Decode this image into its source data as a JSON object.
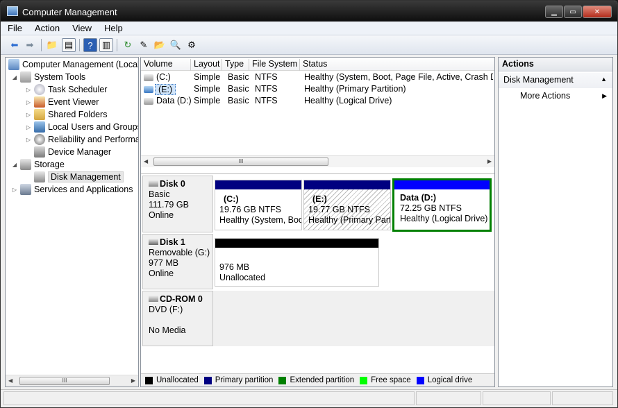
{
  "window": {
    "title": "Computer Management",
    "minimize": "▁",
    "maximize": "▭",
    "close": "✕"
  },
  "menu": [
    "File",
    "Action",
    "View",
    "Help"
  ],
  "tree": {
    "root": "Computer Management (Local",
    "system_tools": "System Tools",
    "task_scheduler": "Task Scheduler",
    "event_viewer": "Event Viewer",
    "shared_folders": "Shared Folders",
    "local_users": "Local Users and Groups",
    "reliability": "Reliability and Performa",
    "device_manager": "Device Manager",
    "storage": "Storage",
    "disk_management": "Disk Management",
    "services": "Services and Applications"
  },
  "volumes": {
    "headers": [
      "Volume",
      "Layout",
      "Type",
      "File System",
      "Status"
    ],
    "rows": [
      {
        "volume": "(C:)",
        "layout": "Simple",
        "type": "Basic",
        "fs": "NTFS",
        "status": "Healthy (System, Boot, Page File, Active, Crash Dum"
      },
      {
        "volume": "(E:)",
        "layout": "Simple",
        "type": "Basic",
        "fs": "NTFS",
        "status": "Healthy (Primary Partition)"
      },
      {
        "volume": "Data (D:)",
        "layout": "Simple",
        "type": "Basic",
        "fs": "NTFS",
        "status": "Healthy (Logical Drive)"
      }
    ]
  },
  "disks": {
    "disk0": {
      "name": "Disk 0",
      "type": "Basic",
      "size": "111.79 GB",
      "state": "Online"
    },
    "disk1": {
      "name": "Disk 1",
      "type": "Removable (G:)",
      "size": "977 MB",
      "state": "Online"
    },
    "cdrom0": {
      "name": "CD-ROM 0",
      "type": "DVD (F:)",
      "state": "No Media"
    }
  },
  "partitions": {
    "c": {
      "name": "(C:)",
      "size": "19.76 GB NTFS",
      "status": "Healthy (System, Boo"
    },
    "e": {
      "name": "(E:)",
      "size": "19.77 GB NTFS",
      "status": "Healthy (Primary Part"
    },
    "d": {
      "name": "Data  (D:)",
      "size": "72.25 GB NTFS",
      "status": "Healthy (Logical Drive)"
    },
    "g": {
      "size": "976 MB",
      "status": "Unallocated"
    }
  },
  "legend": [
    {
      "label": "Unallocated",
      "color": "#000000"
    },
    {
      "label": "Primary partition",
      "color": "#000080"
    },
    {
      "label": "Extended partition",
      "color": "#008000"
    },
    {
      "label": "Free space",
      "color": "#00ff00"
    },
    {
      "label": "Logical drive",
      "color": "#0000ff"
    }
  ],
  "actions": {
    "title": "Actions",
    "section": "Disk Management",
    "more": "More Actions"
  },
  "scroll_thumb": "III"
}
